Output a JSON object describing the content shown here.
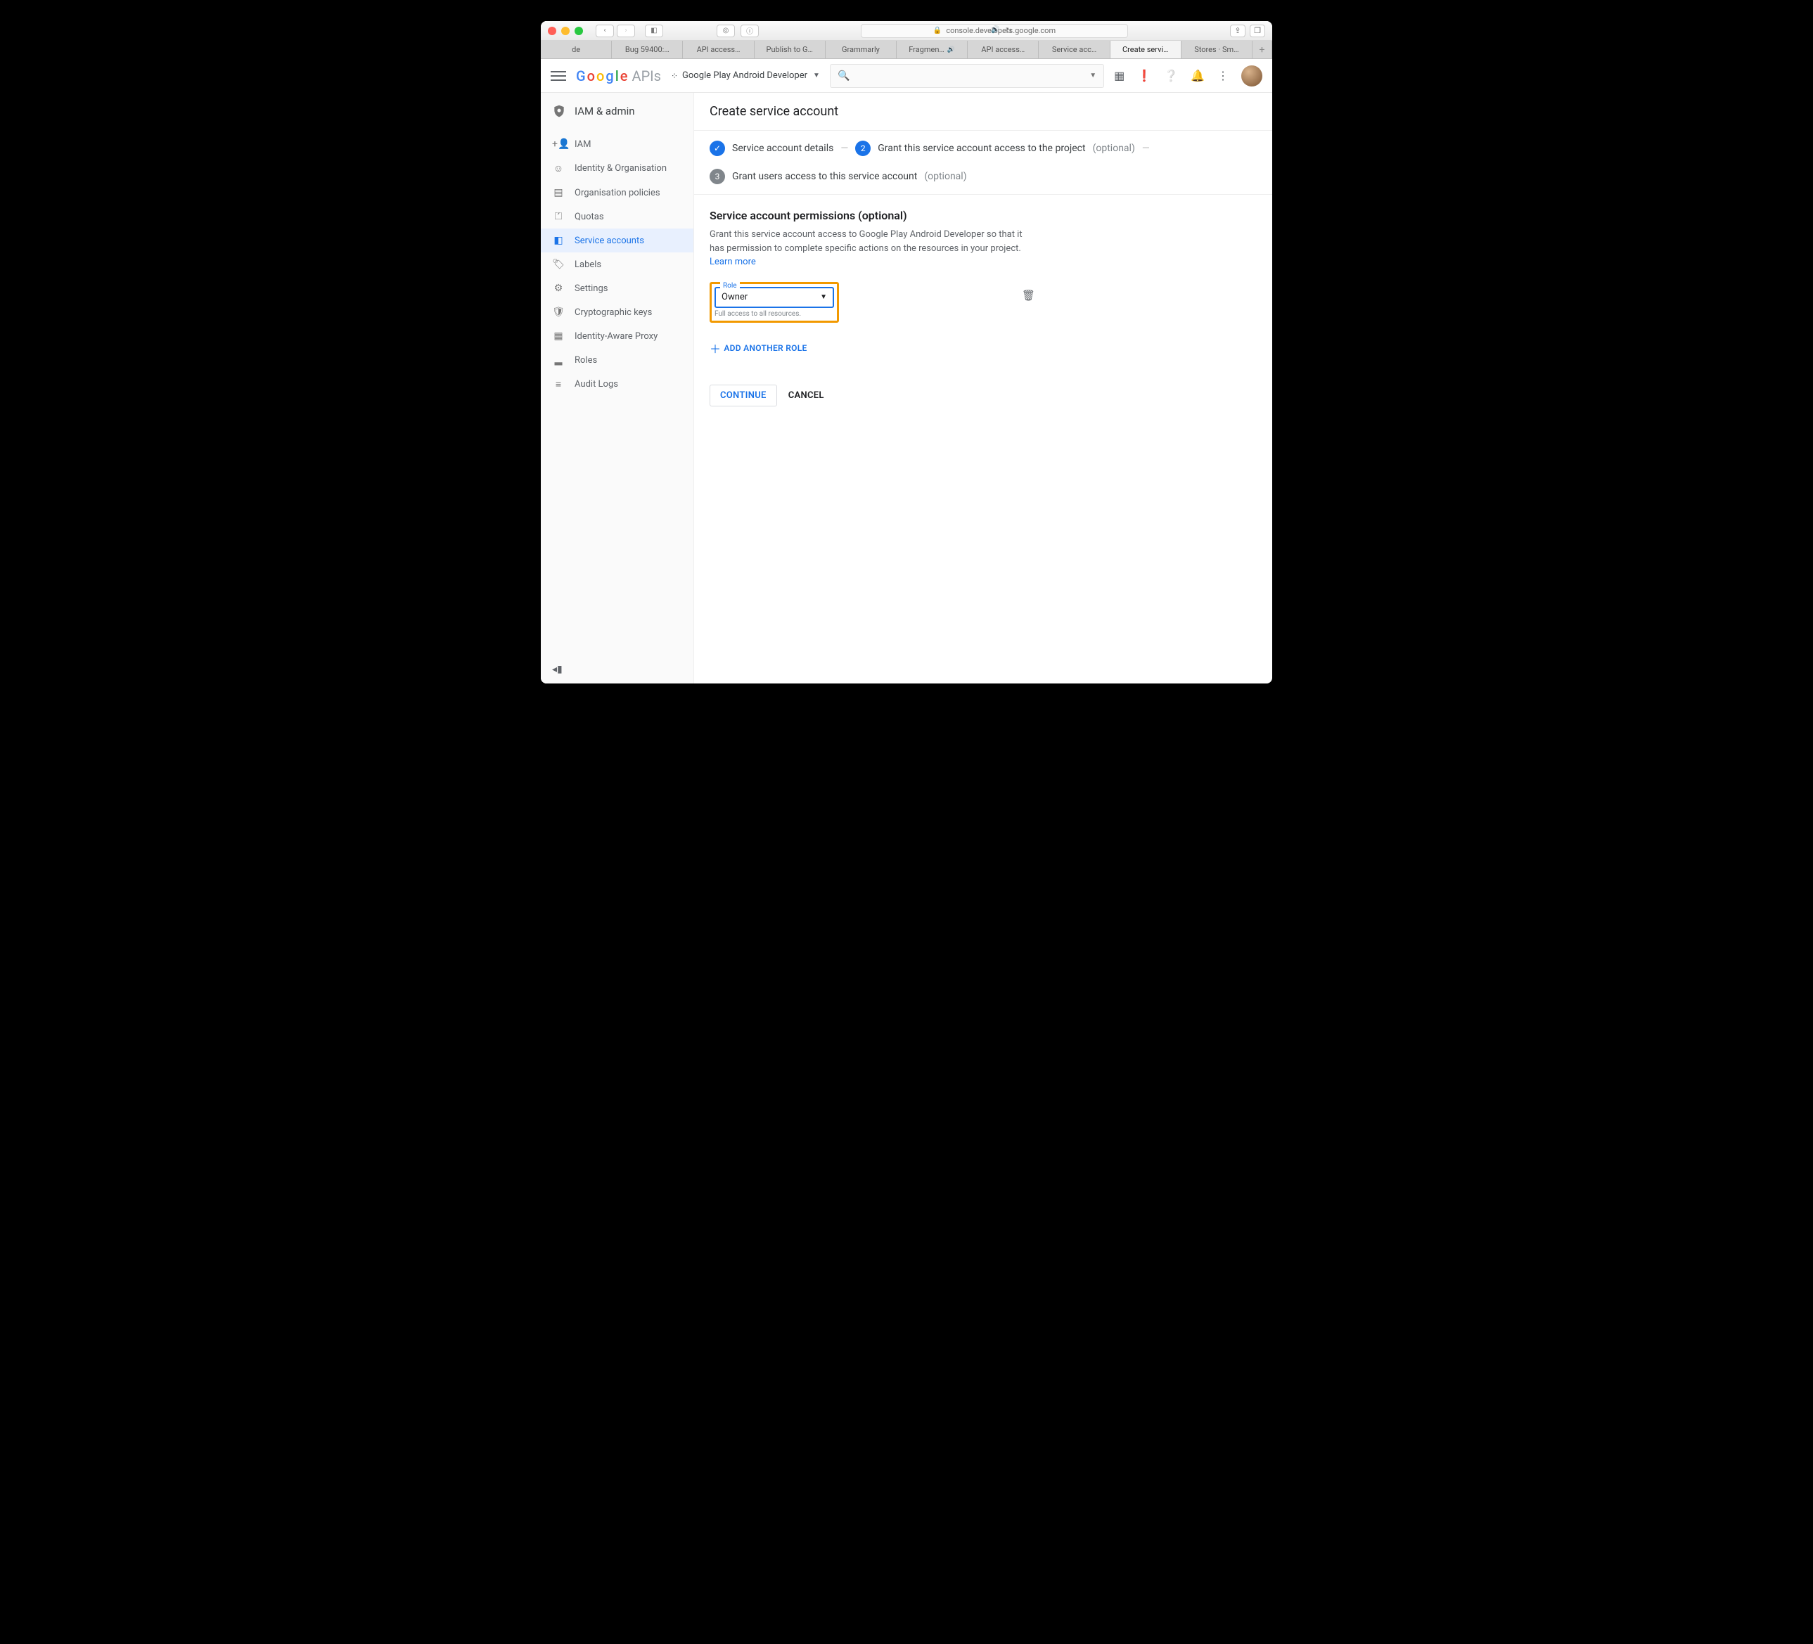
{
  "browser": {
    "url_host": "console.developers.google.com",
    "tabs": [
      "de",
      "Bug 59400:…",
      "API access…",
      "Publish to G…",
      "Grammarly",
      "Fragmen…",
      "API access…",
      "Service acc…",
      "Create servi…",
      "Stores · Sm…"
    ],
    "active_tab_index": 8
  },
  "header": {
    "logo_text": "Google",
    "logo_suffix": "APIs",
    "project_name": "Google Play Android Developer"
  },
  "sidebar": {
    "section": "IAM & admin",
    "items": [
      {
        "icon": "+👤",
        "label": "IAM"
      },
      {
        "icon": "☺",
        "label": "Identity & Organisation"
      },
      {
        "icon": "▤",
        "label": "Organisation policies"
      },
      {
        "icon": "⏍",
        "label": "Quotas"
      },
      {
        "icon": "◧",
        "label": "Service accounts"
      },
      {
        "icon": "🏷",
        "label": "Labels"
      },
      {
        "icon": "⚙",
        "label": "Settings"
      },
      {
        "icon": "🛡",
        "label": "Cryptographic keys"
      },
      {
        "icon": "▦",
        "label": "Identity-Aware Proxy"
      },
      {
        "icon": "▂",
        "label": "Roles"
      },
      {
        "icon": "≡",
        "label": "Audit Logs"
      }
    ],
    "active_index": 4
  },
  "page": {
    "title": "Create service account",
    "steps": {
      "s1": "Service account details",
      "s2": "Grant this service account access to the project",
      "s2_opt": "(optional)",
      "s3": "Grant users access to this service account",
      "s3_opt": "(optional)",
      "s3_num": "3",
      "s2_num": "2",
      "check": "✓"
    },
    "section_title": "Service account permissions (optional)",
    "section_desc": "Grant this service account access to Google Play Android Developer so that it has permission to complete specific actions on the resources in your project. ",
    "learn_more": "Learn more",
    "role": {
      "label": "Role",
      "value": "Owner",
      "help": "Full access to all resources."
    },
    "add_another": "ADD ANOTHER ROLE",
    "continue": "CONTINUE",
    "cancel": "CANCEL"
  }
}
